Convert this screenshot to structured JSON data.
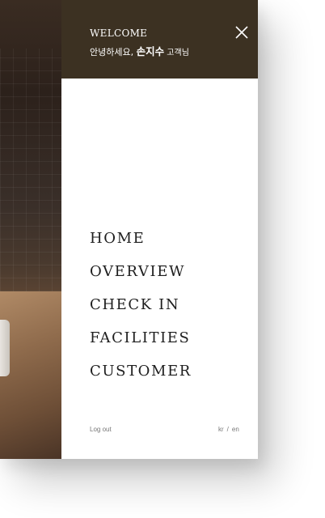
{
  "header": {
    "welcome": "WELCOME",
    "greeting_prefix": "안녕하세요, ",
    "user_name": "손지수",
    "greeting_suffix": " 고객님"
  },
  "icons": {
    "close": "close-icon"
  },
  "menu": {
    "items": [
      {
        "label": "HOME"
      },
      {
        "label": "OVERVIEW"
      },
      {
        "label": "CHECK IN"
      },
      {
        "label": "FACILITIES"
      },
      {
        "label": "CUSTOMER"
      }
    ]
  },
  "footer": {
    "logout": "Log out",
    "lang_kr": "kr",
    "lang_sep": "/",
    "lang_en": "en"
  },
  "colors": {
    "header_bg": "#3c3122",
    "menu_text": "#1e1e1e",
    "footer_text": "#777777"
  }
}
